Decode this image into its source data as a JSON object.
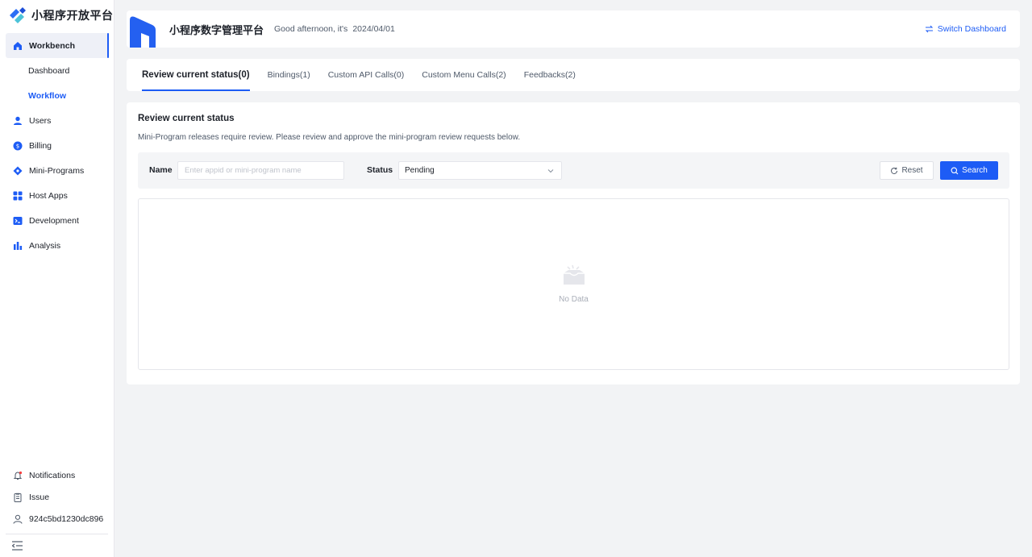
{
  "brand": {
    "name": "小程序开放平台"
  },
  "sidebar": {
    "items": [
      {
        "label": "Workbench",
        "icon": "home-icon"
      },
      {
        "label": "Users",
        "icon": "user-icon"
      },
      {
        "label": "Billing",
        "icon": "billing-icon"
      },
      {
        "label": "Mini-Programs",
        "icon": "mini-program-icon"
      },
      {
        "label": "Host Apps",
        "icon": "apps-grid-icon"
      },
      {
        "label": "Development",
        "icon": "terminal-icon"
      },
      {
        "label": "Analysis",
        "icon": "bar-chart-icon"
      }
    ],
    "sub_items": [
      {
        "label": "Dashboard"
      },
      {
        "label": "Workflow"
      }
    ],
    "bottom": [
      {
        "label": "Notifications",
        "icon": "bell-icon"
      },
      {
        "label": "Issue",
        "icon": "clipboard-icon"
      },
      {
        "label": "924c5bd1230dc896",
        "icon": "user-outline-icon"
      }
    ]
  },
  "header": {
    "title": "小程序数字管理平台",
    "greeting": "Good afternoon, it's",
    "date": "2024/04/01",
    "switch_label": "Switch Dashboard"
  },
  "tabs": [
    {
      "label": "Review current status(0)"
    },
    {
      "label": "Bindings(1)"
    },
    {
      "label": "Custom API Calls(0)"
    },
    {
      "label": "Custom Menu Calls(2)"
    },
    {
      "label": "Feedbacks(2)"
    }
  ],
  "main": {
    "title": "Review current status",
    "description": "Mini-Program releases require review. Please review and approve the mini-program review requests below.",
    "filter": {
      "name_label": "Name",
      "name_placeholder": "Enter appid or mini-program name",
      "status_label": "Status",
      "status_value": "Pending",
      "reset_label": "Reset",
      "search_label": "Search"
    },
    "empty_text": "No Data"
  },
  "colors": {
    "accent": "#1d5cf5",
    "background": "#f2f3f5"
  }
}
